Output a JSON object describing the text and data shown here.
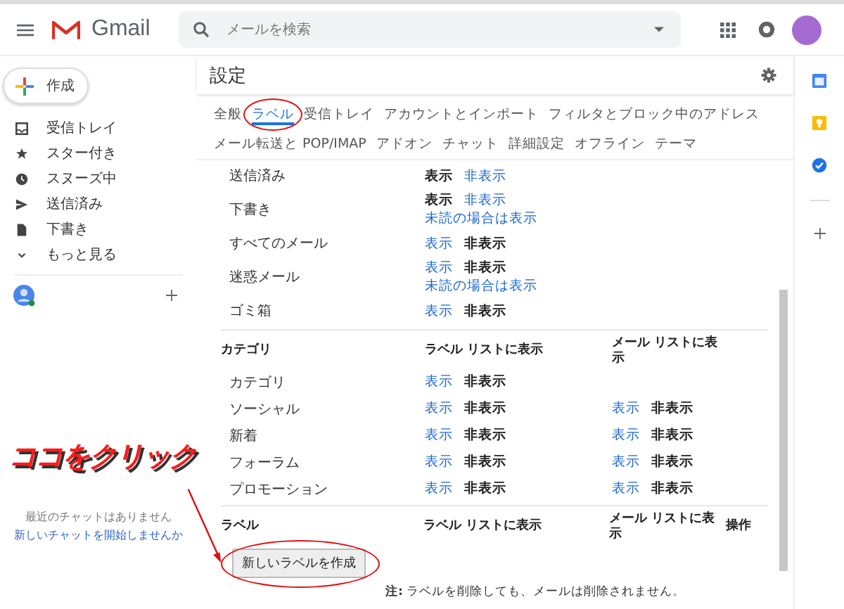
{
  "header": {
    "app_name": "Gmail",
    "search": {
      "placeholder": "メールを検索"
    }
  },
  "sidebar": {
    "compose": "作成",
    "items": [
      {
        "label": "受信トレイ",
        "kind": "inbox"
      },
      {
        "label": "スター付き",
        "kind": "starred"
      },
      {
        "label": "スヌーズ中",
        "kind": "snoozed"
      },
      {
        "label": "送信済み",
        "kind": "sent"
      },
      {
        "label": "下書き",
        "kind": "drafts"
      },
      {
        "label": "もっと見る",
        "kind": "more"
      }
    ],
    "chat": {
      "empty": "最近のチャットはありません",
      "link": "新しいチャットを開始しませんか"
    }
  },
  "settings": {
    "title": "設定",
    "tab_rows": [
      {
        "tabs": [
          {
            "label": "全般",
            "selected": false,
            "circled": false
          },
          {
            "label": "ラベル",
            "selected": true,
            "circled": true
          },
          {
            "label": "受信トレイ",
            "selected": false,
            "circled": false
          },
          {
            "label": "アカウントとインポート",
            "selected": false,
            "circled": false
          },
          {
            "label": "フィルタとブロック中のアドレス",
            "selected": false,
            "circled": false
          }
        ]
      },
      {
        "tabs": [
          {
            "label": "メール転送と POP/IMAP",
            "selected": false,
            "circled": false
          },
          {
            "label": "アドオン",
            "selected": false,
            "circled": false
          },
          {
            "label": "チャット",
            "selected": false,
            "circled": false
          },
          {
            "label": "詳細設定",
            "selected": false,
            "circled": false
          },
          {
            "label": "オフライン",
            "selected": false,
            "circled": false
          },
          {
            "label": "テーマ",
            "selected": false,
            "circled": false
          }
        ]
      }
    ],
    "system_labels": [
      {
        "name": "送信済み",
        "label_list": [
          {
            "text": "表示",
            "selected": true
          },
          {
            "text": "非表示",
            "selected": false
          }
        ]
      },
      {
        "name": "下書き",
        "label_list": [
          {
            "text": "表示",
            "selected": true
          },
          {
            "text": "非表示",
            "selected": false
          }
        ],
        "unread_link": "未読の場合は表示"
      },
      {
        "name": "すべてのメール",
        "label_list": [
          {
            "text": "表示",
            "selected": false
          },
          {
            "text": "非表示",
            "selected": true
          }
        ]
      },
      {
        "name": "迷惑メール",
        "label_list": [
          {
            "text": "表示",
            "selected": false
          },
          {
            "text": "非表示",
            "selected": true
          }
        ],
        "unread_link": "未読の場合は表示"
      },
      {
        "name": "ゴミ箱",
        "label_list": [
          {
            "text": "表示",
            "selected": false
          },
          {
            "text": "非表示",
            "selected": true
          }
        ]
      }
    ],
    "categories": {
      "heading": "カテゴリ",
      "columns": [
        "ラベル リストに表示",
        "メール リストに表示"
      ],
      "rows": [
        {
          "name": "カテゴリ",
          "label_list": [
            {
              "text": "表示",
              "selected": false
            },
            {
              "text": "非表示",
              "selected": true
            }
          ]
        },
        {
          "name": "ソーシャル",
          "label_list": [
            {
              "text": "表示",
              "selected": false
            },
            {
              "text": "非表示",
              "selected": true
            }
          ],
          "mail_list": [
            {
              "text": "表示",
              "selected": false
            },
            {
              "text": "非表示",
              "selected": true
            }
          ]
        },
        {
          "name": "新着",
          "label_list": [
            {
              "text": "表示",
              "selected": false
            },
            {
              "text": "非表示",
              "selected": true
            }
          ],
          "mail_list": [
            {
              "text": "表示",
              "selected": false
            },
            {
              "text": "非表示",
              "selected": true
            }
          ]
        },
        {
          "name": "フォーラム",
          "label_list": [
            {
              "text": "表示",
              "selected": false
            },
            {
              "text": "非表示",
              "selected": true
            }
          ],
          "mail_list": [
            {
              "text": "表示",
              "selected": false
            },
            {
              "text": "非表示",
              "selected": true
            }
          ]
        },
        {
          "name": "プロモーション",
          "label_list": [
            {
              "text": "表示",
              "selected": false
            },
            {
              "text": "非表示",
              "selected": true
            }
          ],
          "mail_list": [
            {
              "text": "表示",
              "selected": false
            },
            {
              "text": "非表示",
              "selected": true
            }
          ]
        }
      ]
    },
    "labels": {
      "heading": "ラベル",
      "columns": [
        "ラベル リストに表示",
        "メール リストに表示",
        "操作"
      ],
      "create_button": {
        "label": "新しいラベルを作成",
        "circled": true
      },
      "note": "**注:** ラベルを削除しても、メールは削除されません。"
    }
  },
  "annotation": {
    "text": "ココをクリック"
  }
}
